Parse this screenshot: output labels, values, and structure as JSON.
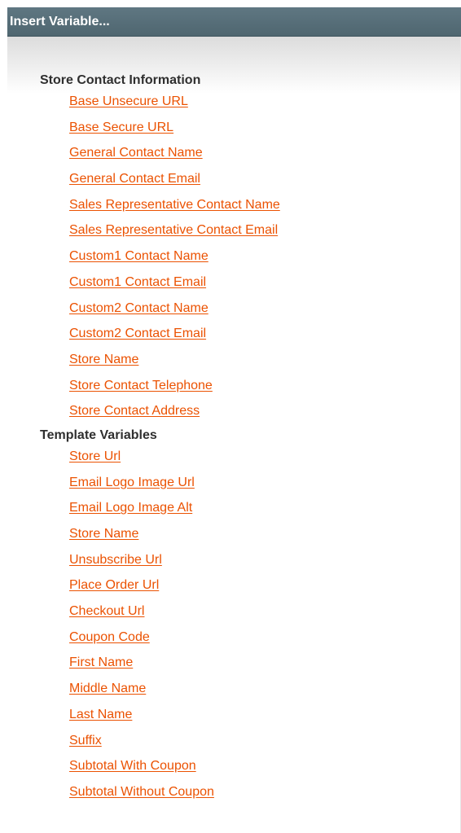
{
  "dialog": {
    "title": "Insert Variable..."
  },
  "groups": [
    {
      "label": "Store Contact Information",
      "items": [
        "Base Unsecure URL",
        "Base Secure URL",
        "General Contact Name",
        "General Contact Email",
        "Sales Representative Contact Name",
        "Sales Representative Contact Email",
        "Custom1 Contact Name",
        "Custom1 Contact Email",
        "Custom2 Contact Name",
        "Custom2 Contact Email",
        "Store Name",
        "Store Contact Telephone",
        "Store Contact Address"
      ]
    },
    {
      "label": "Template Variables",
      "items": [
        "Store Url",
        "Email Logo Image Url",
        "Email Logo Image Alt",
        "Store Name",
        "Unsubscribe Url",
        "Place Order Url",
        "Checkout Url",
        "Coupon Code",
        "First Name",
        "Middle Name",
        "Last Name",
        "Suffix",
        "Subtotal With Coupon",
        "Subtotal Without Coupon"
      ]
    }
  ],
  "colors": {
    "titlebar": "#56707b",
    "link": "#eb5202",
    "group_label": "#2f2f2f"
  }
}
